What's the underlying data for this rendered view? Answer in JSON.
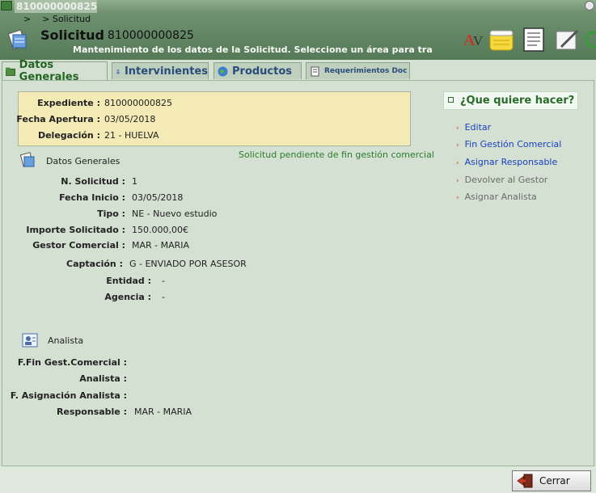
{
  "window": {
    "title": "810000000825"
  },
  "header": {
    "breadcrumb": ">    > Solicitud",
    "title": "Solicitud",
    "number": "810000000825",
    "subtitle": "Mantenimiento de los datos de la Solicitud. Seleccione un área para tra"
  },
  "tabs": [
    {
      "label": "Datos Generales",
      "active": true
    },
    {
      "label": "Intervinientes"
    },
    {
      "label": "Productos"
    },
    {
      "label": "Requerimientos Doc"
    }
  ],
  "expediente": {
    "expediente_label": "Expediente :",
    "expediente_value": "810000000825",
    "fecha_label": "Fecha Apertura :",
    "fecha_value": "03/05/2018",
    "delegacion_label": "Delegación :",
    "delegacion_value": "21 - HUELVA"
  },
  "status": "Solicitud pendiente de fin gestión comercial",
  "datos_generales": {
    "title": "Datos Generales",
    "n_solicitud_label": "N. Solicitud :",
    "n_solicitud_value": "1",
    "fecha_inicio_label": "Fecha Inicio :",
    "fecha_inicio_value": "03/05/2018",
    "tipo_label": "Tipo :",
    "tipo_value": "NE - Nuevo estudio",
    "importe_label": "Importe Solicitado :",
    "importe_value": "150.000,00€",
    "gestor_label": "Gestor Comercial :",
    "gestor_value": "MAR - MARIA",
    "captacion_label": "Captación :",
    "captacion_value": "G - ENVIADO POR ASESOR",
    "entidad_label": "Entidad :",
    "entidad_value": "-",
    "agencia_label": "Agencia :",
    "agencia_value": "-"
  },
  "analista": {
    "title": "Analista",
    "ffin_label": "F.Fin Gest.Comercial :",
    "analista_label": "Analista :",
    "fasig_label": "F. Asignación Analista :",
    "responsable_label": "Responsable :",
    "responsable_value": "MAR - MARIA"
  },
  "side": {
    "title": "¿Que quiere hacer?",
    "actions": [
      {
        "label": "Editar"
      },
      {
        "label": "Fin Gestión Comercial"
      },
      {
        "label": "Asignar Responsable"
      },
      {
        "label": "Devolver al Gestor"
      },
      {
        "label": "Asignar Analista"
      }
    ]
  },
  "footer": {
    "close_label": "Cerrar"
  },
  "icons": [
    "window-icon",
    "close-window-icon",
    "solicitud-icon",
    "av-icon",
    "notes-icon",
    "document-icon",
    "edit-pencil-icon",
    "refresh-icon",
    "folder-icon",
    "person-icon",
    "globe-icon",
    "document-tab-icon",
    "datos-icon",
    "analista-icon",
    "arrow-box-icon",
    "exit-door-icon"
  ]
}
